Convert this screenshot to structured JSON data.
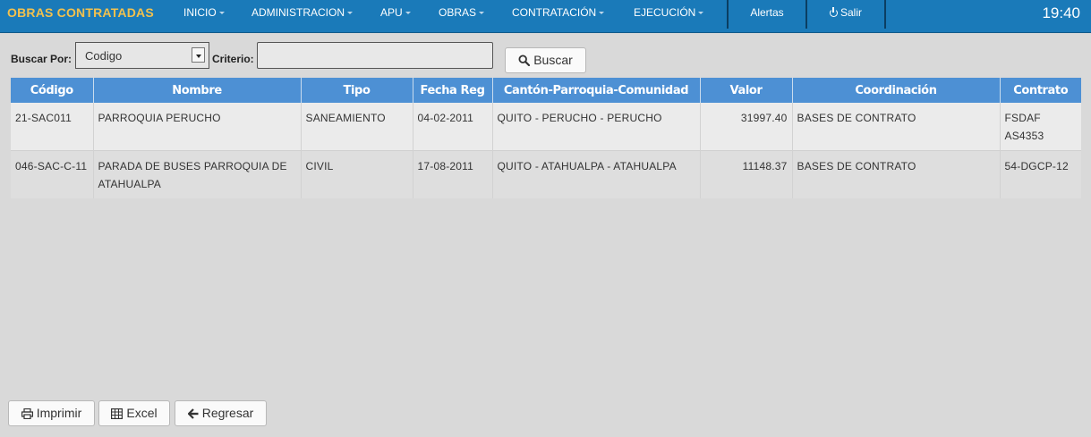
{
  "nav": {
    "brand": "OBRAS CONTRATADAS",
    "menu": [
      {
        "label": "INICIO"
      },
      {
        "label": "ADMINISTRACION"
      },
      {
        "label": "APU"
      },
      {
        "label": "OBRAS"
      },
      {
        "label": "CONTRATACIÓN"
      },
      {
        "label": "EJECUCIÓN"
      }
    ],
    "alerts_label": "Alertas",
    "logout_label": "Salir",
    "clock": "19:40"
  },
  "search": {
    "buscar_por_label": "Buscar Por:",
    "selected_option": "Codigo",
    "criterio_label": "Criterio:",
    "criterio_value": "",
    "buscar_button": "Buscar"
  },
  "table": {
    "headers": [
      "Código",
      "Nombre",
      "Tipo",
      "Fecha Reg",
      "Cantón-Parroquia-Comunidad",
      "Valor",
      "Coordinación",
      "Contrato"
    ],
    "rows": [
      {
        "codigo": "21-SAC011",
        "nombre": "PARROQUIA PERUCHO",
        "tipo": "SANEAMIENTO",
        "fecha": "04-02-2011",
        "ubicacion": "QUITO - PERUCHO - PERUCHO",
        "valor": "31997.40",
        "coordinacion": "BASES DE CONTRATO",
        "contrato": "FSDAF AS4353"
      },
      {
        "codigo": "046-SAC-C-11",
        "nombre": "PARADA DE BUSES PARROQUIA DE ATAHUALPA",
        "tipo": "CIVIL",
        "fecha": "17-08-2011",
        "ubicacion": "QUITO - ATAHUALPA - ATAHUALPA",
        "valor": "11148.37",
        "coordinacion": "BASES DE CONTRATO",
        "contrato": "54-DGCP-12"
      }
    ]
  },
  "footer": {
    "print_button": "Imprimir",
    "excel_button": "Excel",
    "back_button": "Regresar"
  },
  "colors": {
    "navbar": "#1a7ab9",
    "brand": "#f2c14e",
    "table_header": "#4d90d4"
  },
  "icons": [
    "caret-down-icon",
    "power-icon",
    "search-icon",
    "print-icon",
    "table-icon",
    "arrow-left-icon"
  ]
}
